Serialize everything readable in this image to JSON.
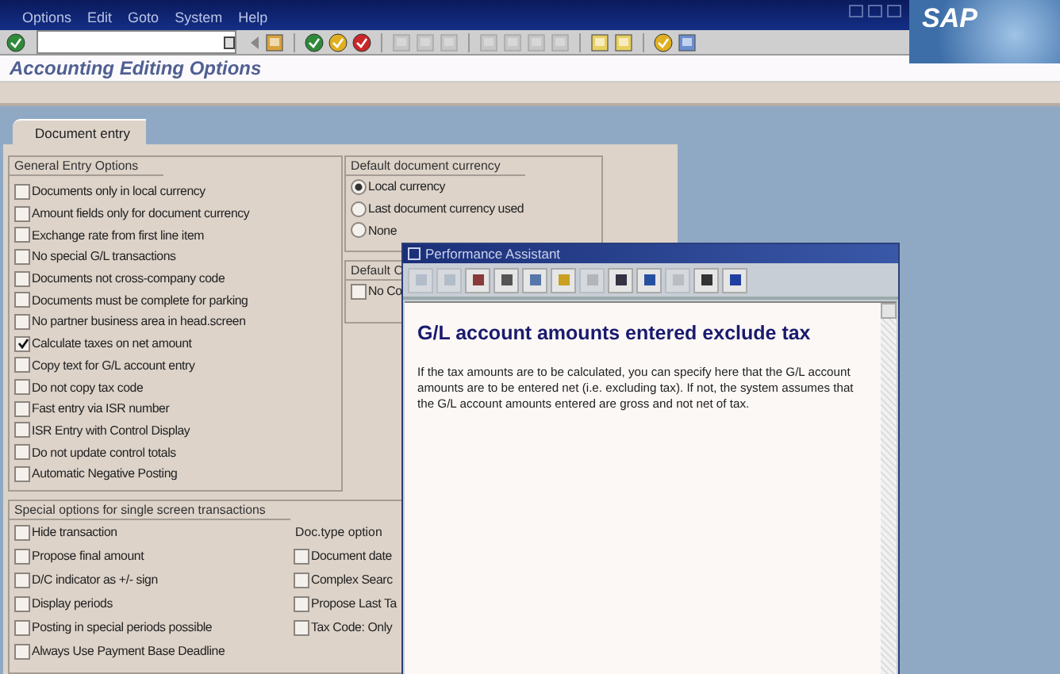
{
  "menu": [
    "Options",
    "Edit",
    "Goto",
    "System",
    "Help"
  ],
  "logo": "SAP",
  "title": "Accounting Editing Options",
  "tabs": [
    {
      "label": "Document entry",
      "selected": true
    }
  ],
  "general_entry_options": {
    "title": "General Entry Options",
    "items": [
      {
        "label": "Documents only in local currency",
        "checked": false
      },
      {
        "label": "Amount fields only for document currency",
        "checked": false
      },
      {
        "label": "Exchange rate from first line item",
        "checked": false
      },
      {
        "label": "No special G/L transactions",
        "checked": false
      },
      {
        "label": "Documents not cross-company code",
        "checked": false
      },
      {
        "label": "Documents must be complete for parking",
        "checked": false
      },
      {
        "label": "No partner business area in head.screen",
        "checked": false
      },
      {
        "label": "Calculate taxes on net amount",
        "checked": true
      },
      {
        "label": "Copy text for G/L account entry",
        "checked": false
      },
      {
        "label": "Do not copy tax code",
        "checked": false
      },
      {
        "label": "Fast entry via ISR number",
        "checked": false
      },
      {
        "label": "ISR Entry with Control Display",
        "checked": false
      },
      {
        "label": "Do not update control totals",
        "checked": false
      },
      {
        "label": "Automatic Negative Posting",
        "checked": false
      }
    ]
  },
  "default_document_currency": {
    "title": "Default document currency",
    "options": [
      {
        "label": "Local currency",
        "selected": true
      },
      {
        "label": "Last document currency used",
        "selected": false
      },
      {
        "label": "None",
        "selected": false
      }
    ]
  },
  "default_c": {
    "title": "Default C",
    "items": [
      {
        "label": "No Co",
        "checked": false
      }
    ]
  },
  "special_options": {
    "title": "Special options for single screen transactions",
    "items": [
      {
        "label": "Hide transaction",
        "checked": false
      },
      {
        "label": "Propose final amount",
        "checked": false
      },
      {
        "label": "D/C indicator as +/- sign",
        "checked": false
      },
      {
        "label": "Display periods",
        "checked": false
      },
      {
        "label": "Posting in special periods possible",
        "checked": false
      },
      {
        "label": "Always Use Payment Base Deadline",
        "checked": false
      }
    ],
    "doc_type_option": {
      "title": "Doc.type option",
      "items": [
        {
          "label": "Document date",
          "checked": false
        },
        {
          "label": "Complex Searc",
          "checked": false
        },
        {
          "label": "Propose Last Ta",
          "checked": false
        },
        {
          "label": "Tax Code: Only",
          "checked": false
        }
      ]
    }
  },
  "performance_assistant": {
    "title": "Performance Assistant",
    "heading": "G/L account amounts entered exclude tax",
    "body": "If the tax amounts are to be calculated, you can specify here that the G/L account amounts are to be entered net (i.e. excluding tax). If not, the system assumes that the G/L account amounts entered are gross and not net of tax."
  }
}
